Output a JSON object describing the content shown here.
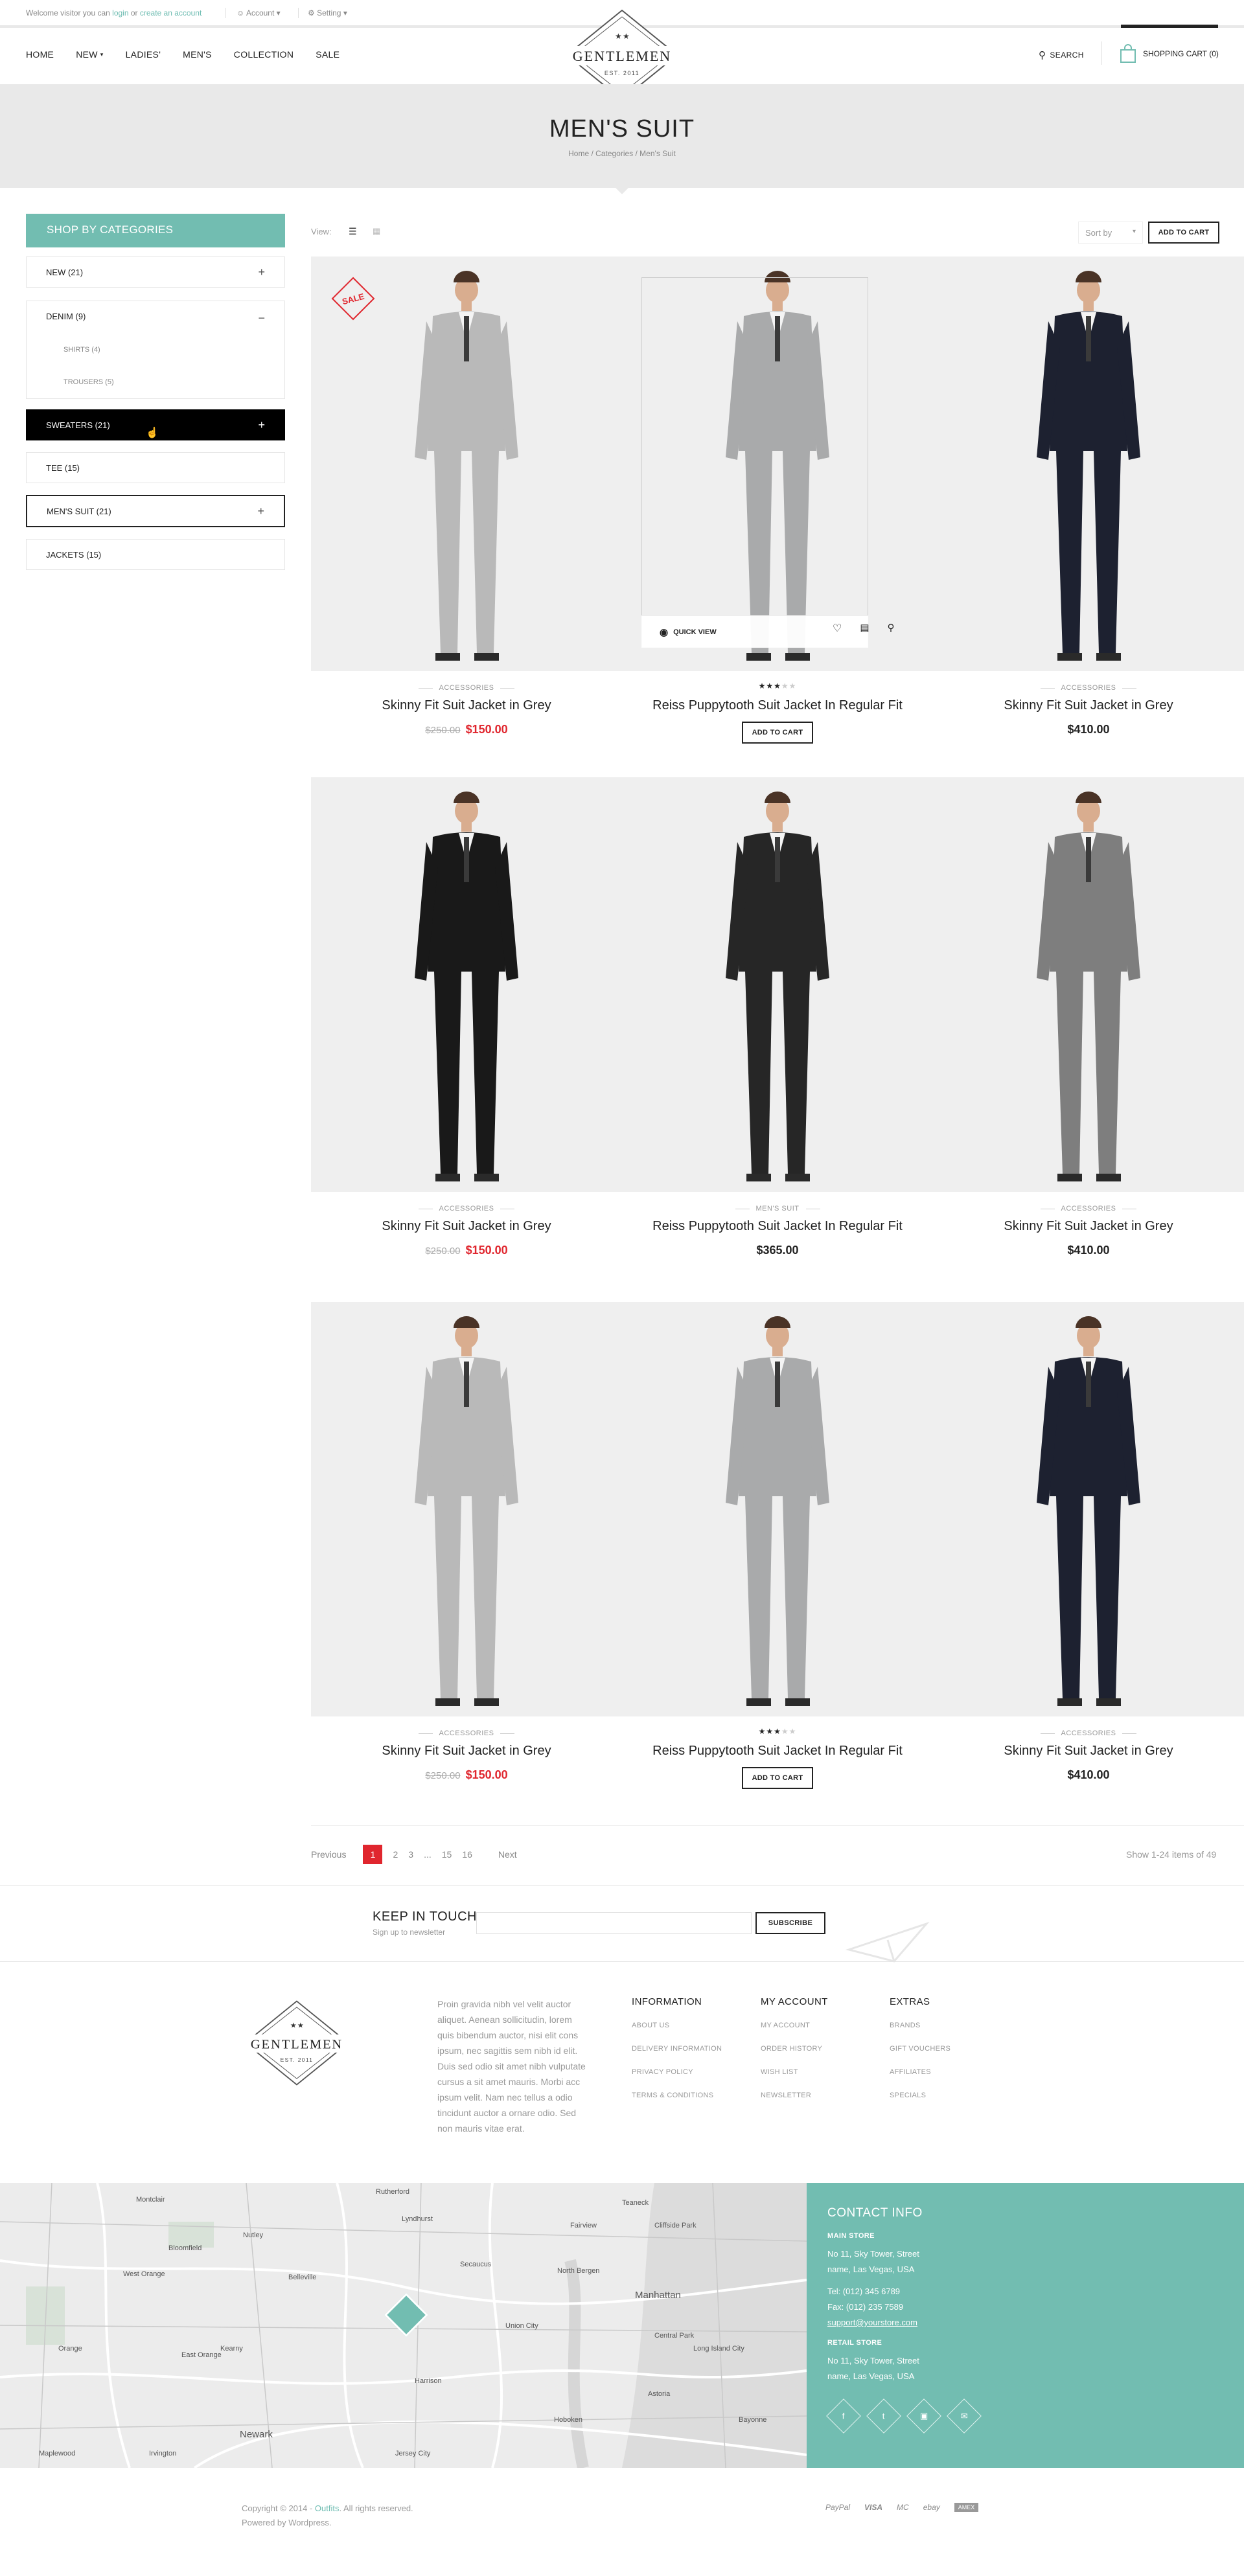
{
  "topbar": {
    "welcome_prefix": "Welcome visitor you can ",
    "login_link": "login",
    "or": " or ",
    "create_link": "create an account",
    "account": "Account",
    "setting": "Setting"
  },
  "nav": [
    "HOME",
    "NEW",
    "LADIES'",
    "MEN'S",
    "COLLECTION",
    "SALE"
  ],
  "logo": {
    "text": "GENTLEMEN",
    "est": "EST. 2011"
  },
  "header": {
    "search": "SEARCH",
    "cart": "SHOPPING CART (0)"
  },
  "banner": {
    "title": "MEN'S SUIT",
    "breadcrumb": "Home  /  Categories  /  Men's Suit"
  },
  "sidebar": {
    "title": "SHOP BY CATEGORIES",
    "items": [
      {
        "label": "NEW (21)",
        "toggle": "+"
      },
      {
        "label": "DENIM (9)",
        "toggle": "−"
      },
      {
        "label": "SWEATERS (21)",
        "toggle": "+"
      },
      {
        "label": "TEE (15)",
        "toggle": ""
      },
      {
        "label": "MEN'S SUIT (21)",
        "toggle": "+"
      },
      {
        "label": "JACKETS (15)",
        "toggle": ""
      }
    ],
    "subitems": [
      "SHIRTS (4)",
      "TROUSERS (5)"
    ]
  },
  "toolbar": {
    "view": "View:",
    "sort": "Sort by",
    "add_to_cart": "ADD TO CART"
  },
  "products": [
    {
      "category": "ACCESSORIES",
      "name": "Skinny Fit Suit Jacket in Grey",
      "old_price": "$250.00",
      "price": "$150.00",
      "badge": "SALE"
    },
    {
      "category": "",
      "name": "Reiss Puppytooth Suit Jacket In Regular Fit",
      "rating": 3,
      "button": "ADD TO CART",
      "quick_view": "QUICK VIEW"
    },
    {
      "category": "ACCESSORIES",
      "name": "Skinny Fit Suit Jacket in Grey",
      "price": "$410.00"
    },
    {
      "category": "ACCESSORIES",
      "name": "Skinny Fit Suit Jacket in Grey",
      "old_price": "$250.00",
      "price": "$150.00"
    },
    {
      "category": "MEN'S SUIT",
      "name": "Reiss Puppytooth Suit Jacket In Regular Fit",
      "price": "$365.00"
    },
    {
      "category": "ACCESSORIES",
      "name": "Skinny Fit Suit Jacket in Grey",
      "price": "$410.00"
    },
    {
      "category": "ACCESSORIES",
      "name": "Skinny Fit Suit Jacket in Grey",
      "old_price": "$250.00",
      "price": "$150.00"
    },
    {
      "category": "",
      "name": "Reiss Puppytooth Suit Jacket In Regular Fit",
      "rating": 3,
      "button": "ADD TO CART"
    },
    {
      "category": "ACCESSORIES",
      "name": "Skinny Fit Suit Jacket in Grey",
      "price": "$410.00"
    }
  ],
  "pagination": {
    "prev": "Previous",
    "pages": [
      "1",
      "2",
      "3",
      "...",
      "15",
      "16"
    ],
    "next": "Next",
    "current": "1",
    "showing": "Show 1-24 items of 49"
  },
  "newsletter": {
    "title": "KEEP IN TOUCH",
    "subtitle": "Sign up to newsletter",
    "button": "SUBSCRIBE"
  },
  "footer": {
    "about": "Proin gravida nibh vel velit auctor aliquet. Aenean sollicitudin, lorem quis bibendum auctor, nisi elit cons ipsum, nec sagittis sem nibh id elit. Duis sed odio sit amet nibh vulputate cursus a sit amet mauris. Morbi acc ipsum velit. Nam nec tellus a odio tincidunt auctor a ornare odio. Sed non mauris vitae erat.",
    "columns": [
      {
        "title": "INFORMATION",
        "links": [
          "ABOUT US",
          "DELIVERY INFORMATION",
          "PRIVACY POLICY",
          "TERMS & CONDITIONS"
        ]
      },
      {
        "title": "MY ACCOUNT",
        "links": [
          "MY ACCOUNT",
          "ORDER HISTORY",
          "WISH LIST",
          "NEWSLETTER"
        ]
      },
      {
        "title": "EXTRAS",
        "links": [
          "BRANDS",
          "GIFT VOUCHERS",
          "AFFILIATES",
          "SPECIALS"
        ]
      }
    ]
  },
  "map": {
    "places": [
      "Montclair",
      "Bloomfield",
      "West Orange",
      "Belleville",
      "Nutley",
      "Kearny",
      "Secaucus",
      "North Bergen",
      "Union City",
      "Manhattan",
      "Hoboken",
      "Newark",
      "East Orange",
      "Orange",
      "Jersey City",
      "Astoria",
      "Bayonne",
      "Irvington",
      "Maplewood",
      "Rutherford",
      "Lyndhurst",
      "Teaneck",
      "Cliffside Park",
      "Fairview",
      "Harrison",
      "Long Island City",
      "Central Park"
    ]
  },
  "contact": {
    "title": "CONTACT INFO",
    "main_label": "MAIN STORE",
    "main_address_1": "No 11, Sky Tower, Street",
    "main_address_2": "name, Las Vegas, USA",
    "tel": "Tel: (012) 345 6789",
    "fax": "Fax: (012) 235 7589",
    "email": "support@yourstore.com",
    "retail_label": "RETAIL STORE",
    "retail_address_1": "No 11, Sky Tower, Street",
    "retail_address_2": "name, Las Vegas, USA"
  },
  "copyright": {
    "line1_prefix": "Copyright © 2014 - ",
    "brand": "Outfits",
    "line1_suffix": ". All rights reserved.",
    "line2": "Powered by Wordpress."
  },
  "payments": [
    "PayPal",
    "VISA",
    "MC",
    "ebay",
    "AMEX"
  ],
  "colors": {
    "accent": "#72bdb1",
    "sale": "#e0262e",
    "dark": "#222222"
  }
}
